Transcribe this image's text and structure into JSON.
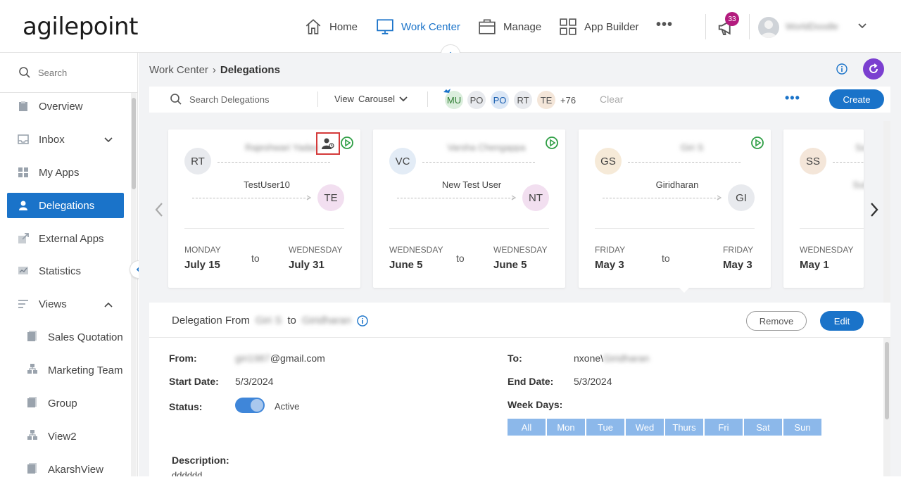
{
  "app": {
    "logo_text": "agilepoint"
  },
  "nav": {
    "items": [
      {
        "label": "Home",
        "icon": "home-icon"
      },
      {
        "label": "Work Center",
        "icon": "monitor-icon",
        "active": true
      },
      {
        "label": "Manage",
        "icon": "briefcase-icon"
      },
      {
        "label": "App Builder",
        "icon": "grid-icon"
      }
    ],
    "more": "•••",
    "notifications_count": "33",
    "user_name": "WorldDoodle"
  },
  "sidebar": {
    "search_placeholder": "Search",
    "items": [
      {
        "label": "Overview",
        "icon": "clipboard-icon"
      },
      {
        "label": "Inbox",
        "icon": "inbox-icon"
      },
      {
        "label": "My Apps",
        "icon": "apps-grid-icon"
      },
      {
        "label": "Delegations",
        "icon": "person-icon"
      },
      {
        "label": "External Apps",
        "icon": "external-link-icon"
      },
      {
        "label": "Statistics",
        "icon": "chart-icon"
      },
      {
        "label": "Views",
        "icon": "list-icon"
      }
    ],
    "views": [
      {
        "label": "Sales Quotation",
        "icon": "document-icon"
      },
      {
        "label": "Marketing Team",
        "icon": "hierarchy-icon"
      },
      {
        "label": "Group",
        "icon": "document-icon"
      },
      {
        "label": "View2",
        "icon": "hierarchy-icon"
      },
      {
        "label": "AkarshView",
        "icon": "document-icon"
      }
    ]
  },
  "breadcrumb": {
    "parent": "Work Center",
    "sep": "›",
    "current": "Delegations"
  },
  "toolbar": {
    "search_placeholder": "Search Delegations",
    "view_label": "View",
    "view_value": "Carousel",
    "chips": [
      "MU",
      "PO",
      "PO",
      "RT",
      "TE"
    ],
    "more_count": "+76",
    "clear": "Clear",
    "ellipsis": "•••",
    "create": "Create"
  },
  "cards": [
    {
      "from_initials": "RT",
      "from_name": "Rajeshwari Yadav",
      "to_name": "TestUser10",
      "to_initials": "TE",
      "start_day": "MONDAY",
      "start_date": "July 15",
      "to_word": "to",
      "end_day": "WEDNESDAY",
      "end_date": "July 31"
    },
    {
      "from_initials": "VC",
      "from_name": "Varsha Chengappa",
      "to_name": "New Test User",
      "to_initials": "NT",
      "start_day": "WEDNESDAY",
      "start_date": "June 5",
      "to_word": "to",
      "end_day": "WEDNESDAY",
      "end_date": "June 5"
    },
    {
      "from_initials": "GS",
      "from_name": "Giri S",
      "to_name": "Giridharan",
      "to_initials": "GI",
      "start_day": "FRIDAY",
      "start_date": "May 3",
      "to_word": "to",
      "end_day": "FRIDAY",
      "end_date": "May 3"
    },
    {
      "from_initials": "SS",
      "from_name": "Sa",
      "to_name": "Sub",
      "to_initials": "",
      "start_day": "WEDNESDAY",
      "start_date": "May 1",
      "to_word": "",
      "end_day": "",
      "end_date": ""
    }
  ],
  "detail": {
    "title_prefix": "Delegation From",
    "title_from": "Giri S",
    "title_to_word": "to",
    "title_to": "Giridharan",
    "remove": "Remove",
    "edit": "Edit",
    "from_label": "From:",
    "from_user_blur": "giri1987",
    "from_domain": "@gmail.com",
    "to_label": "To:",
    "to_prefix": "nxone\\",
    "to_user_blur": "Giridharan",
    "start_label": "Start Date:",
    "start_value": "5/3/2024",
    "end_label": "End Date:",
    "end_value": "5/3/2024",
    "status_label": "Status:",
    "status_value": "Active",
    "weekdays_label": "Week Days:",
    "weekdays": [
      "All",
      "Mon",
      "Tue",
      "Wed",
      "Thurs",
      "Fri",
      "Sat",
      "Sun"
    ],
    "description_label": "Description:",
    "description_value": "dddddd"
  },
  "colors": {
    "primary": "#1a73c9",
    "sidebar_active": "#1a73c9",
    "badge": "#b31c7e",
    "refresh": "#7b3fd0",
    "weekday": "#8cb8ea"
  }
}
